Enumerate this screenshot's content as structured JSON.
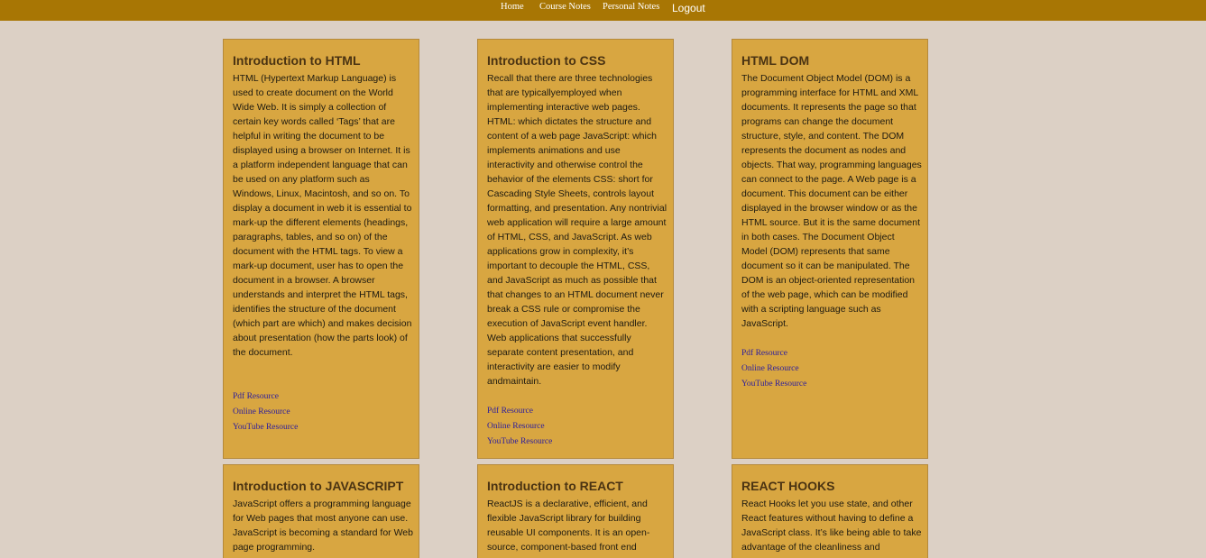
{
  "nav": {
    "home": "Home",
    "course_notes": "Course Notes",
    "personal_notes": "Personal Notes",
    "logout": "Logout"
  },
  "cards": [
    {
      "title": "Introduction to HTML",
      "body": "HTML (Hypertext Markup Language) is used to create document on the World Wide Web. It is simply a collection of certain key words called ‘Tags’ that are helpful in writing the document to be displayed using a browser on Internet. It is a platform independent language that can be used on any platform such as Windows, Linux, Macintosh, and so on. To display a document in web it is essential to mark-up the different elements (headings, paragraphs, tables, and so on) of the document with the HTML tags. To view a mark-up document, user has to open the document in a browser. A browser understands and interpret the HTML tags, identifies the structure of the document (which part are which) and makes decision about presentation (how the parts look) of the document.",
      "links": [
        "Pdf Resource",
        "Online Resource",
        "YouTube Resource"
      ]
    },
    {
      "title": "Introduction to CSS",
      "body": "Recall that there are three technologies that are typicallyemployed when implementing interactive web pages. HTML: which dictates the structure and content of a web page JavaScript: which implements animations and use interactivity and otherwise control the behavior of the elements CSS: short for Cascading Style Sheets, controls layout formatting, and presentation. Any nontrivial web application will require a large amount of HTML, CSS, and JavaScript. As web applications grow in complexity, it’s important to decouple the HTML, CSS, and JavaScript as much as possible that that changes to an HTML document never break a CSS rule or compromise the execution of JavaScript event handler. Web applications that successfully separate content presentation, and interactivity are easier to modify andmaintain.",
      "links": [
        "Pdf Resource",
        "Online Resource",
        "YouTube Resource"
      ]
    },
    {
      "title": "HTML DOM",
      "body": "The Document Object Model (DOM) is a programming interface for HTML and XML documents. It represents the page so that programs can change the document structure, style, and content. The DOM represents the document as nodes and objects. That way, programming languages can connect to the page. A Web page is a document. This document can be either displayed in the browser window or as the HTML source. But it is the same document in both cases. The Document Object Model (DOM) represents that same document so it can be manipulated. The DOM is an object-oriented representation of the web page, which can be modified with a scripting language such as JavaScript.",
      "links": [
        "Pdf Resource",
        "Online Resource",
        "YouTube Resource"
      ]
    },
    {
      "title": "Introduction to JAVASCRIPT",
      "body": "JavaScript offers a programming language for Web pages that most anyone can use. JavaScript is becoming a standard for Web page programming.",
      "links": []
    },
    {
      "title": "Introduction to REACT",
      "body": "ReactJS is a declarative, efficient, and flexible JavaScript library for building reusable UI components. It is an open-source, component-based front end",
      "links": []
    },
    {
      "title": "REACT HOOKS",
      "body": "React Hooks let you use state, and other React features without having to define a JavaScript class. It’s like being able to take advantage of the cleanliness and",
      "links": []
    }
  ]
}
